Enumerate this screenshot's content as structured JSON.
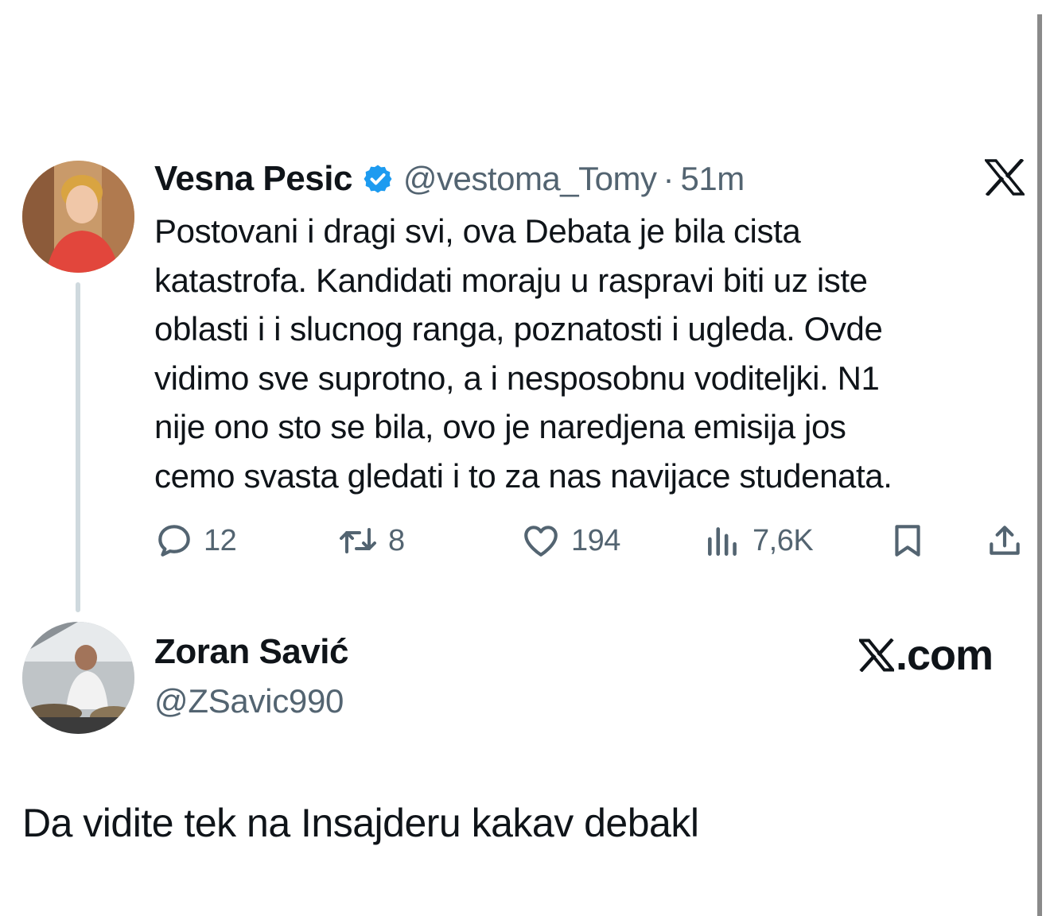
{
  "tweet": {
    "author_name": "Vesna Pesic",
    "author_handle": "@vestoma_Tomy",
    "separator": "·",
    "time": "51m",
    "verified": true,
    "body_lines": [
      "Postovani i dragi svi, ova Debata je bila cista",
      "katastrofa. Kandidati moraju u raspravi biti uz iste",
      "oblasti i i slucnog ranga, poznatosti i ugleda.  Ovde",
      "vidimo sve suprotno, a i nesposobnu voditeljki. N1",
      "nije ono sto se bila, ovo je naredjena emisija jos",
      "cemo svasta gledati i to za nas navijace studenata."
    ],
    "actions": {
      "replies": "12",
      "reposts": "8",
      "likes": "194",
      "views": "7,6K"
    },
    "icons": [
      "x-logo-icon",
      "verified-badge-icon",
      "reply-icon",
      "repost-icon",
      "like-icon",
      "views-icon",
      "bookmark-icon",
      "share-icon"
    ]
  },
  "reply": {
    "author_name": "Zoran Savić",
    "author_handle": "@ZSavic990",
    "brand_text": ".com",
    "body": "Da vidite tek na Insajderu kakav debakl"
  },
  "colors": {
    "text": "#0f1419",
    "secondary": "#536471",
    "verified": "#1d9bf0",
    "thread_line": "#cfd9de"
  }
}
